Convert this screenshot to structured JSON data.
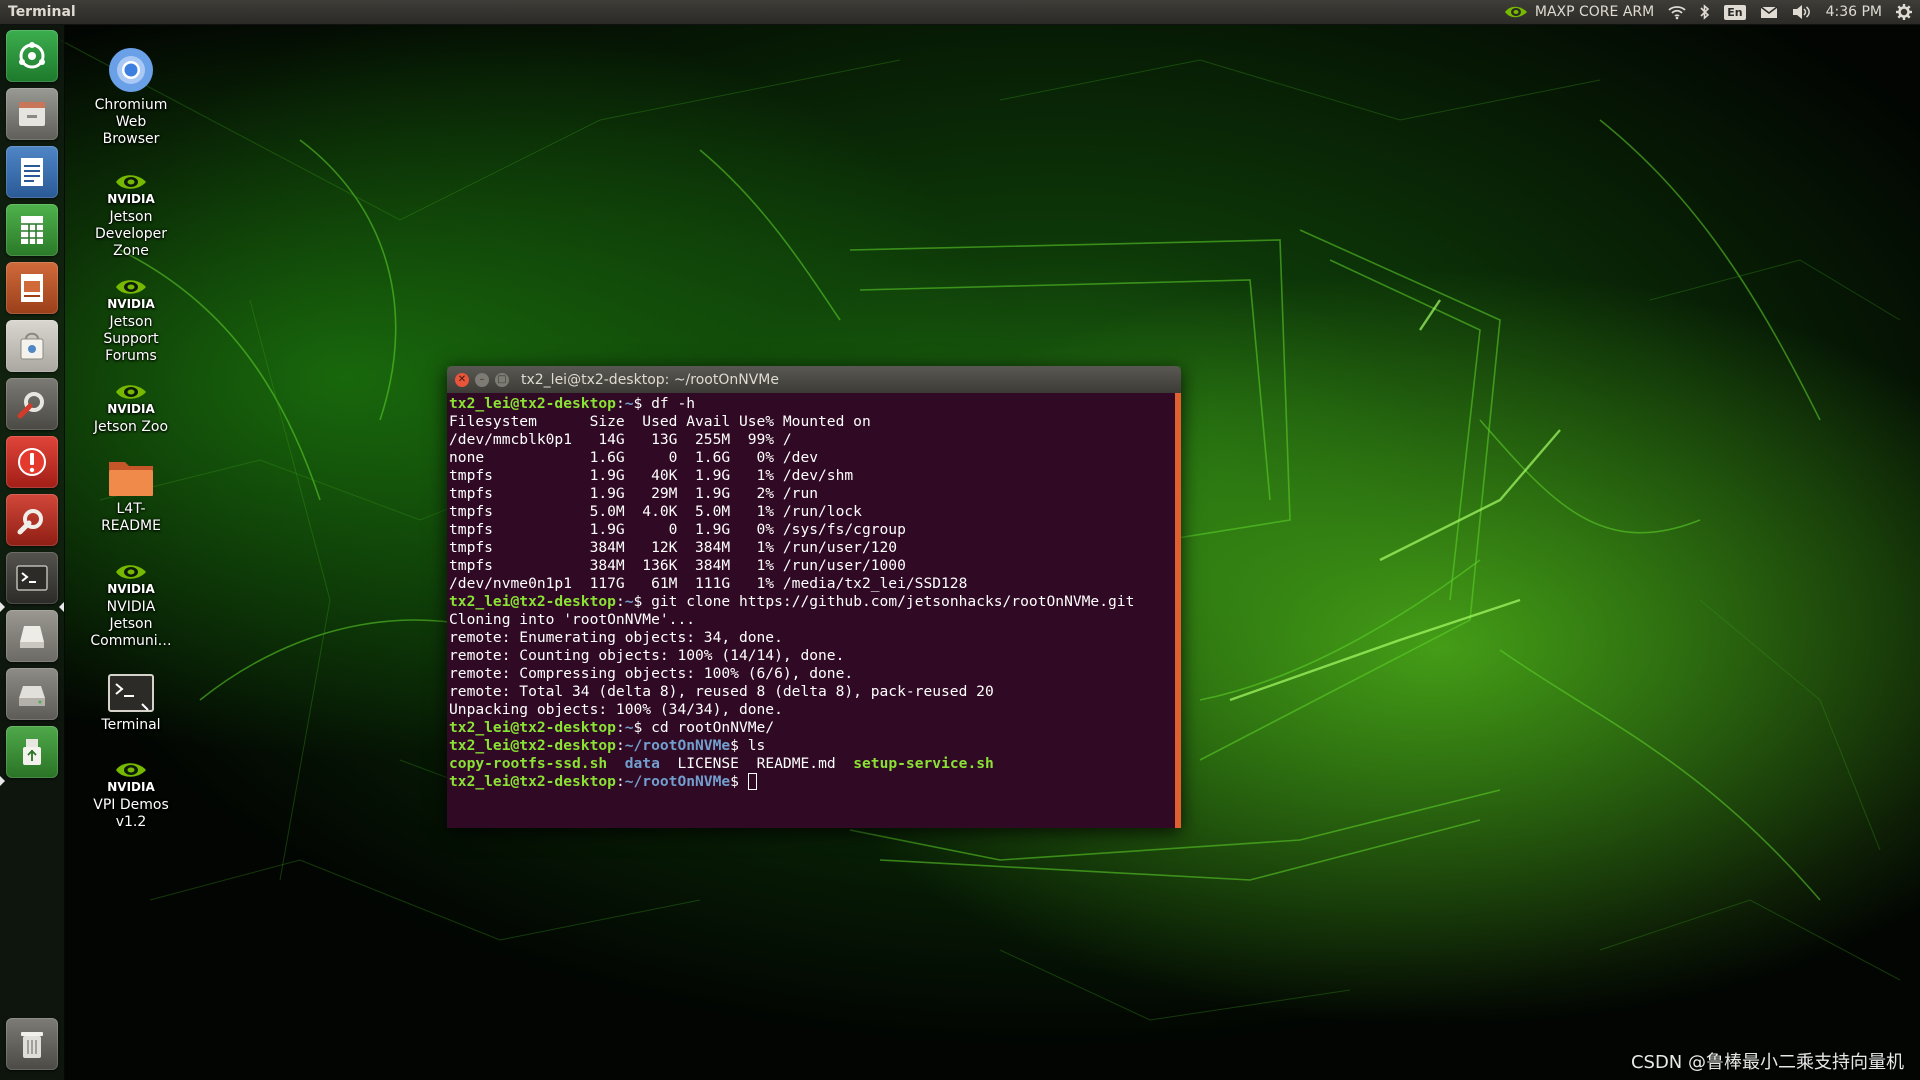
{
  "top_panel": {
    "app_title": "Terminal",
    "power_mode": "MAXP CORE ARM",
    "keyboard_layout": "En",
    "clock": "4:36 PM"
  },
  "launcher": {
    "items": [
      {
        "name": "chromium-launcher",
        "icon": "chromium-icon"
      },
      {
        "name": "files-launcher",
        "icon": "file-cabinet-icon"
      },
      {
        "name": "writer-launcher",
        "icon": "document-icon"
      },
      {
        "name": "calc-launcher",
        "icon": "spreadsheet-icon"
      },
      {
        "name": "impress-launcher",
        "icon": "presentation-icon"
      },
      {
        "name": "software-center-launcher",
        "icon": "shopping-bag-icon"
      },
      {
        "name": "system-settings-launcher",
        "icon": "wrench-gear-icon"
      },
      {
        "name": "error-report-launcher",
        "icon": "alert-icon"
      },
      {
        "name": "software-updater-launcher",
        "icon": "settings-tool-icon"
      },
      {
        "name": "terminal-launcher",
        "icon": "terminal-icon"
      },
      {
        "name": "drive-launcher",
        "icon": "hard-drive-icon"
      },
      {
        "name": "optical-drive-launcher",
        "icon": "disk-drive-icon"
      },
      {
        "name": "usb-launcher",
        "icon": "usb-drive-icon"
      },
      {
        "name": "trash-launcher",
        "icon": "trash-icon"
      }
    ]
  },
  "desktop_icons": [
    {
      "label": "Chromium\nWeb\nBrowser",
      "icon": "chromium-icon"
    },
    {
      "label": "Jetson\nDeveloper\nZone",
      "icon": "nvidia-logo-icon",
      "brand": "NVIDIA"
    },
    {
      "label": "Jetson\nSupport\nForums",
      "icon": "nvidia-logo-icon",
      "brand": "NVIDIA"
    },
    {
      "label": "Jetson Zoo",
      "icon": "nvidia-logo-icon",
      "brand": "NVIDIA"
    },
    {
      "label": "L4T-\nREADME",
      "icon": "folder-icon"
    },
    {
      "label": "NVIDIA\nJetson\nCommuni…",
      "icon": "nvidia-logo-icon",
      "brand": "NVIDIA"
    },
    {
      "label": "Terminal",
      "icon": "terminal-icon"
    },
    {
      "label": "VPI Demos\nv1.2",
      "icon": "nvidia-logo-icon",
      "brand": "NVIDIA"
    }
  ],
  "terminal": {
    "title": "tx2_lei@tx2-desktop: ~/rootOnNVMe",
    "prompt_user": "tx2_lei@tx2-desktop",
    "prompt_home": "~",
    "prompt_repo": "~/rootOnNVMe",
    "cmd_df": " df -h",
    "df_output": [
      "Filesystem      Size  Used Avail Use% Mounted on",
      "/dev/mmcblk0p1   14G   13G  255M  99% /",
      "none            1.6G     0  1.6G   0% /dev",
      "tmpfs           1.9G   40K  1.9G   1% /dev/shm",
      "tmpfs           1.9G   29M  1.9G   2% /run",
      "tmpfs           5.0M  4.0K  5.0M   1% /run/lock",
      "tmpfs           1.9G     0  1.9G   0% /sys/fs/cgroup",
      "tmpfs           384M   12K  384M   1% /run/user/120",
      "tmpfs           384M  136K  384M   1% /run/user/1000",
      "/dev/nvme0n1p1  117G   61M  111G   1% /media/tx2_lei/SSD128"
    ],
    "cmd_clone": " git clone https://github.com/jetsonhacks/rootOnNVMe.git",
    "clone_output": [
      "Cloning into 'rootOnNVMe'...",
      "remote: Enumerating objects: 34, done.",
      "remote: Counting objects: 100% (14/14), done.",
      "remote: Compressing objects: 100% (6/6), done.",
      "remote: Total 34 (delta 8), reused 8 (delta 8), pack-reused 20",
      "Unpacking objects: 100% (34/34), done."
    ],
    "cmd_cd": " cd rootOnNVMe/",
    "cmd_ls": " ls",
    "ls_files": {
      "f1": "copy-rootfs-ssd.sh",
      "f2": "data",
      "f3": "LICENSE",
      "f4": "README.md",
      "f5": "setup-service.sh"
    }
  },
  "watermark": "CSDN @鲁棒最小二乘支持向量机",
  "colors": {
    "terminal_bg": "#300a24",
    "prompt_green": "#8ae234",
    "path_blue": "#729fcf",
    "close_button": "#e9553a",
    "scrollbar": "#e0612f"
  }
}
